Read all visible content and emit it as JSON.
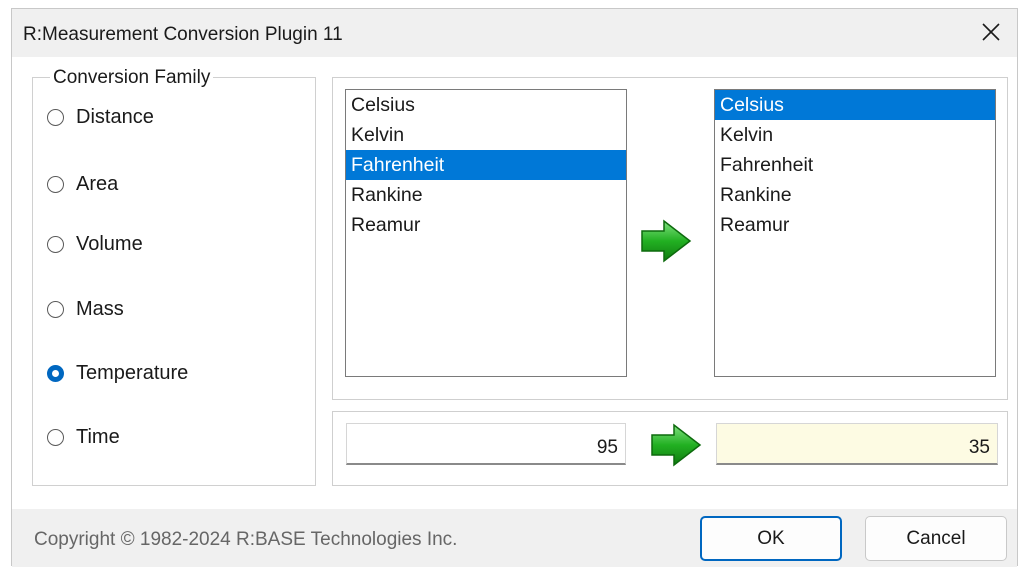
{
  "window": {
    "title": "R:Measurement Conversion Plugin 11",
    "close_icon": "close-icon"
  },
  "conversion_family": {
    "legend": "Conversion Family",
    "options": [
      {
        "label": "Distance",
        "checked": false
      },
      {
        "label": "Area",
        "checked": false
      },
      {
        "label": "Volume",
        "checked": false
      },
      {
        "label": "Mass",
        "checked": false
      },
      {
        "label": "Temperature",
        "checked": true
      },
      {
        "label": "Time",
        "checked": false
      }
    ]
  },
  "from_units": {
    "items": [
      "Celsius",
      "Kelvin",
      "Fahrenheit",
      "Rankine",
      "Reamur"
    ],
    "selected": "Fahrenheit"
  },
  "to_units": {
    "items": [
      "Celsius",
      "Kelvin",
      "Fahrenheit",
      "Rankine",
      "Reamur"
    ],
    "selected": "Celsius"
  },
  "values": {
    "input": "95",
    "result": "35"
  },
  "footer": {
    "copyright": "Copyright © 1982-2024 R:BASE Technologies Inc.",
    "ok_label": "OK",
    "cancel_label": "Cancel"
  },
  "colors": {
    "selection": "#0078d7",
    "radio_checked": "#0067c0",
    "default_button_border": "#0067c0",
    "result_field_bg": "#fdfbe3",
    "arrow_green": "#1fa81f"
  },
  "icons": {
    "units_arrow": "green-right-arrow-icon",
    "value_arrow": "green-right-arrow-icon"
  }
}
